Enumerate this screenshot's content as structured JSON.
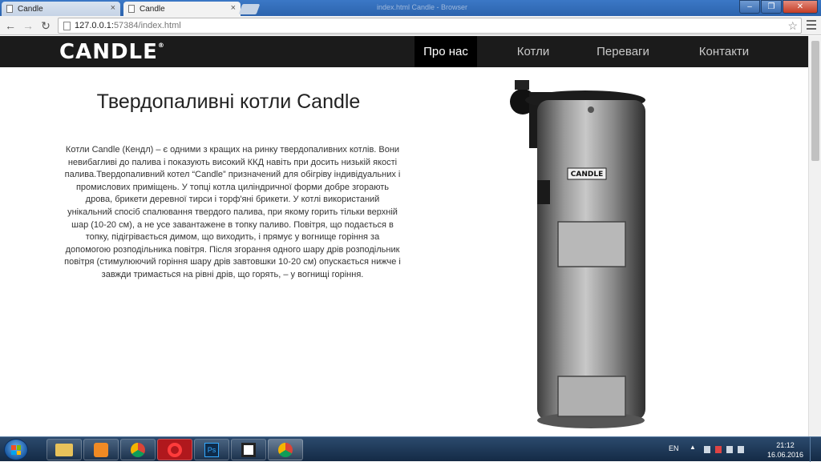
{
  "browser": {
    "tabs": [
      {
        "title": "Candle",
        "active": false
      },
      {
        "title": "Candle",
        "active": true
      }
    ],
    "window_title": "index.html Candle - Browser",
    "url_host": "127.0.0.1:",
    "url_port_path": "57384/index.html"
  },
  "site": {
    "logo": "CANDLE",
    "logo_mark": "®",
    "nav": [
      {
        "label": "Про нас",
        "active": true
      },
      {
        "label": "Котли",
        "active": false
      },
      {
        "label": "Переваги",
        "active": false
      },
      {
        "label": "Контакти",
        "active": false
      }
    ],
    "headline": "Твердопаливні котли Candle",
    "body": "Котли Candle (Кендл) – є одними з кращих на ринку твердопаливних котлів. Вони невибагливі до палива і показують високий ККД навіть при досить низькій якості палива.Твердопаливний котел “Candle” призначений для обігріву індивідуальних і промислових приміщень. У топці котла циліндричної форми добре згорають дрова, брикети деревної тирси і торф'яні брикети. У котлі використаний унікальний спосіб спалювання твердого палива, при якому горить тільки верхній шар (10-20 см), а не усе завантажене в топку паливо. Повітря, що подається в топку, підігрівається димом, що виходить, і прямує у вогнище горіння за допомогою розподільника повітря. Після згорання одного шару дрів розподільник повітря (стимулюючий горіння шару дрів завтовшки 10-20 см) опускається нижче і завжди тримається на рівні дрів, що горять, – у вогнищі горіння.",
    "product_label": "CANDLE"
  },
  "taskbar": {
    "apps": [
      "explorer-icon",
      "media-player-icon",
      "chrome-icon",
      "opera-icon",
      "photoshop-icon",
      "app-icon",
      "chrome-icon"
    ],
    "lang": "EN",
    "time": "21:12",
    "date": "16.06.2016"
  },
  "colors": {
    "nav_bg": "#1b1b1b",
    "nav_active": "#000000",
    "chrome_frame": "#2c63ad"
  }
}
